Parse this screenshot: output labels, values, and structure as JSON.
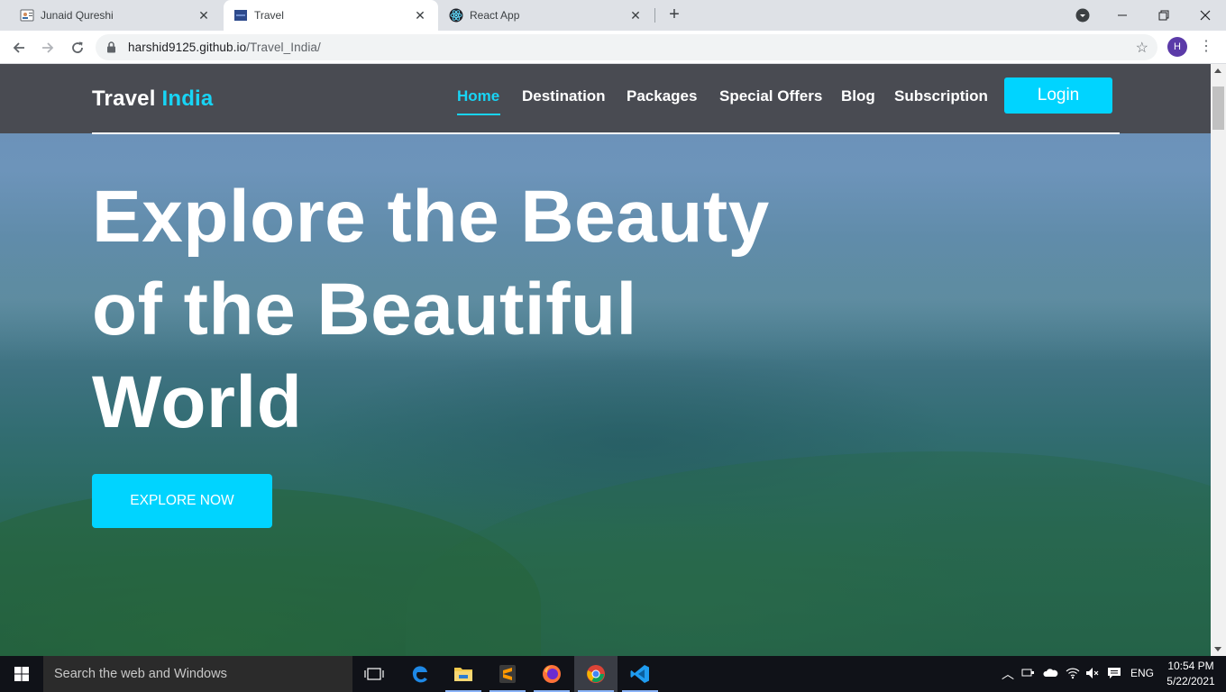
{
  "browser": {
    "tabs": [
      {
        "title": "Junaid Qureshi",
        "icon": "profile-card-icon",
        "active": false
      },
      {
        "title": "Travel",
        "icon": "travel-page-icon",
        "active": true
      },
      {
        "title": "React App",
        "icon": "react-icon",
        "active": false
      }
    ],
    "url_host": "harshid9125.github.io",
    "url_path": "/Travel_India/",
    "profile_initial": "H"
  },
  "site": {
    "brand": {
      "part1": "Travel",
      "part2": "India"
    },
    "nav": [
      "Home",
      "Destination",
      "Packages",
      "Special Offers",
      "Blog",
      "Subscription"
    ],
    "active_nav": "Home",
    "login_label": "Login",
    "headline_lines": [
      "Explore the Beauty",
      "of the Beautiful",
      "World"
    ],
    "cta_label": "EXPLORE NOW",
    "accent_color": "#00d4ff",
    "nav_bg_color": "#48484e"
  },
  "taskbar": {
    "search_placeholder": "Search the web and Windows",
    "apps": [
      "task-view",
      "edge",
      "file-explorer",
      "sublime-text",
      "firefox",
      "chrome",
      "vscode"
    ],
    "language": "ENG",
    "time": "10:54 PM",
    "date": "5/22/2021"
  }
}
